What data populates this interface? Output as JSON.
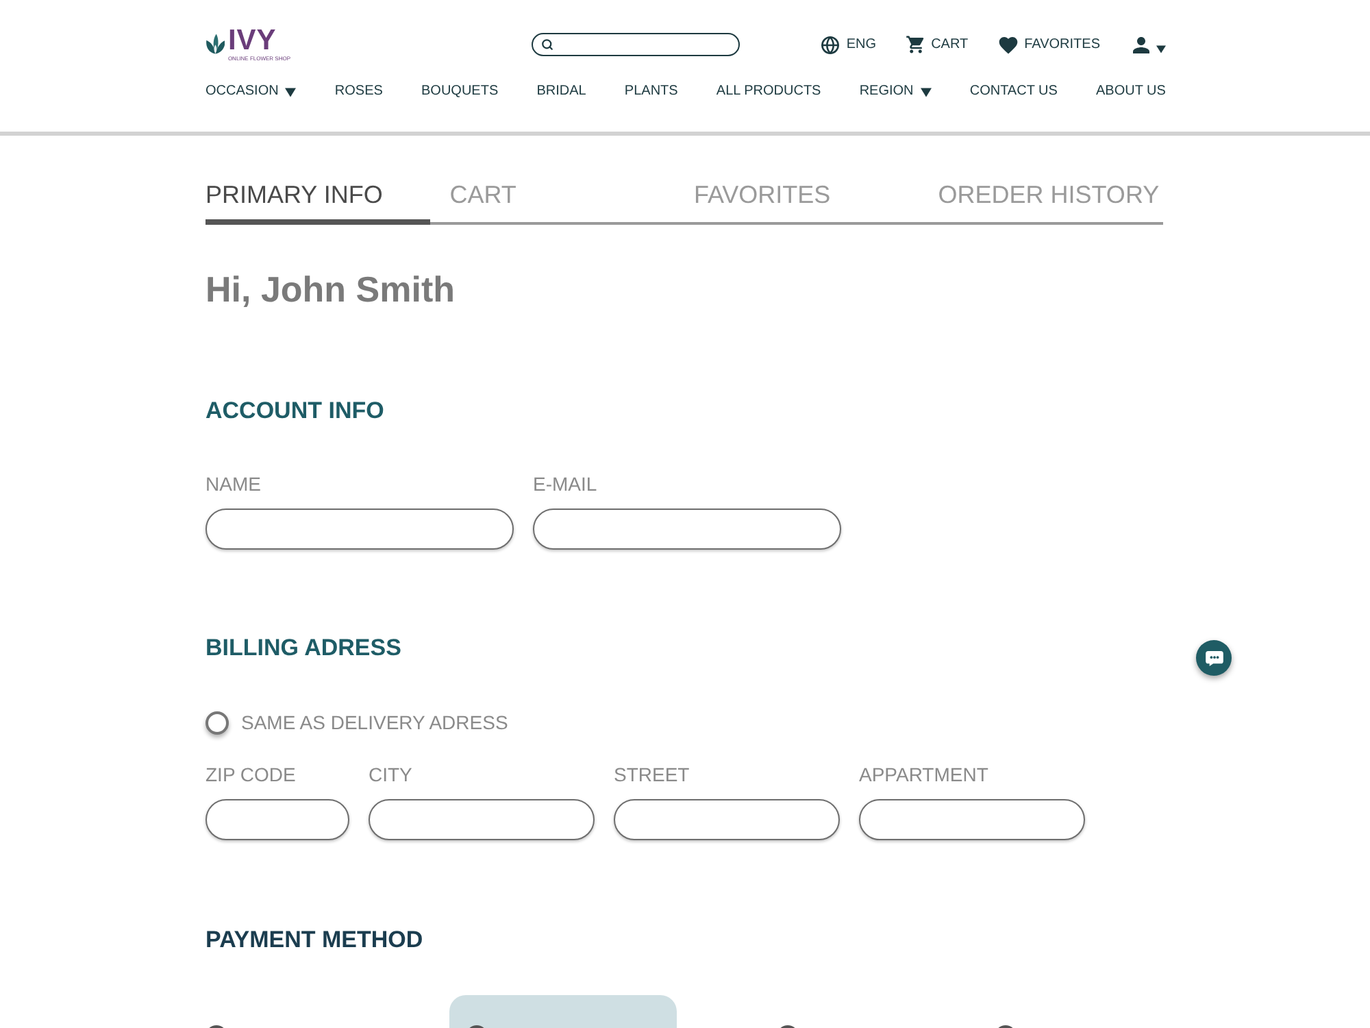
{
  "header": {
    "logo": {
      "name": "IVY",
      "tagline": "ONLINE FLOWER SHOP"
    },
    "utility": [
      {
        "kind": "language",
        "label": "ENG"
      },
      {
        "kind": "cart",
        "label": "CART"
      },
      {
        "kind": "favorites",
        "label": "FAVORITES"
      },
      {
        "kind": "account"
      }
    ],
    "nav": [
      {
        "label": "OCCASION",
        "dropdown": true
      },
      {
        "label": "ROSES",
        "dropdown": false
      },
      {
        "label": "BOUQUETS",
        "dropdown": false
      },
      {
        "label": "BRIDAL",
        "dropdown": false
      },
      {
        "label": "PLANTS",
        "dropdown": false
      },
      {
        "label": "ALL PRODUCTS",
        "dropdown": false
      },
      {
        "label": "REGION",
        "dropdown": true
      },
      {
        "label": "CONTACT US",
        "dropdown": false
      },
      {
        "label": "ABOUT US",
        "dropdown": false
      }
    ]
  },
  "tabs": [
    {
      "label": "PRIMARY INFO",
      "selected": true
    },
    {
      "label": "CART",
      "selected": false
    },
    {
      "label": "FAVORITES",
      "selected": false
    },
    {
      "label": "OREDER HISTORY",
      "selected": false
    }
  ],
  "greeting": "Hi, John Smith",
  "account_info": {
    "title": "ACCOUNT INFO",
    "fields": [
      {
        "label": "NAME"
      },
      {
        "label": "E-MAIL"
      }
    ]
  },
  "billing_address": {
    "title": "BILLING ADRESS",
    "same_as_delivery": {
      "label": "SAME AS DELIVERY ADRESS",
      "checked": false
    },
    "fields": [
      {
        "label": "ZIP CODE"
      },
      {
        "label": "CITY"
      },
      {
        "label": "STREET"
      },
      {
        "label": "APPARTMENT"
      }
    ]
  },
  "payment_method": {
    "title": "PAYMENT METHOD",
    "options": [
      {
        "selected": false
      },
      {
        "selected": true
      },
      {
        "selected": false
      },
      {
        "selected": false
      }
    ]
  }
}
